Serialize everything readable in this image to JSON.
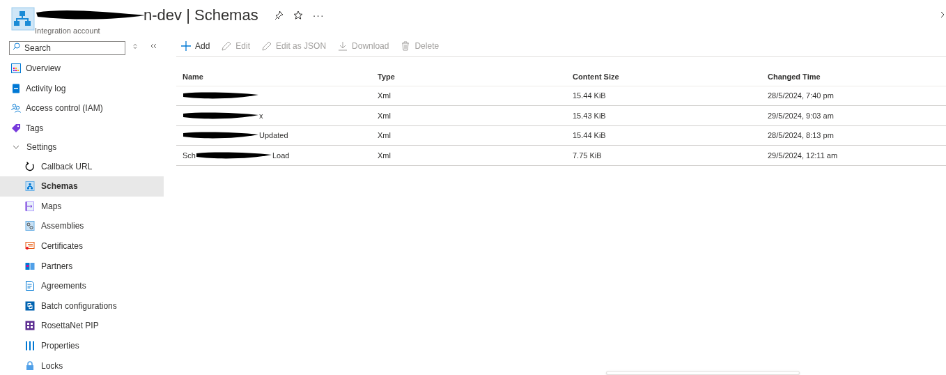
{
  "header": {
    "title": "n-dev | Schemas",
    "more": "···",
    "subtitle": "Integration account"
  },
  "sidebar": {
    "search": {
      "placeholder": "Search"
    },
    "items": [
      {
        "label": "Overview",
        "selected": false
      },
      {
        "label": "Activity log",
        "selected": false
      },
      {
        "label": "Access control (IAM)",
        "selected": false
      },
      {
        "label": "Tags",
        "selected": false
      },
      {
        "label": "Settings",
        "expanded": true,
        "children": [
          {
            "label": "Callback URL",
            "selected": false
          },
          {
            "label": "Schemas",
            "selected": true
          },
          {
            "label": "Maps",
            "selected": false
          },
          {
            "label": "Assemblies",
            "selected": false
          },
          {
            "label": "Certificates",
            "selected": false
          },
          {
            "label": "Partners",
            "selected": false
          },
          {
            "label": "Agreements",
            "selected": false
          },
          {
            "label": "Batch configurations",
            "selected": false
          },
          {
            "label": "RosettaNet PIP",
            "selected": false
          },
          {
            "label": "Properties",
            "selected": false
          },
          {
            "label": "Locks",
            "selected": false
          }
        ]
      }
    ]
  },
  "toolbar": [
    {
      "label": "Add",
      "disabled": false
    },
    {
      "label": "Edit",
      "disabled": true
    },
    {
      "label": "Edit as JSON",
      "disabled": true
    },
    {
      "label": "Download",
      "disabled": true
    },
    {
      "label": "Delete",
      "disabled": true
    }
  ],
  "table": {
    "columns": [
      "Name",
      "Type",
      "Content Size",
      "Changed Time"
    ],
    "rows": [
      {
        "type": "Xml",
        "size": "15.44 KiB",
        "changed": "28/5/2024, 7:40 pm"
      },
      {
        "name_parts": [
          "x"
        ],
        "type": "Xml",
        "size": "15.43 KiB",
        "changed": "29/5/2024, 9:03 am"
      },
      {
        "name_parts": [
          "Updated"
        ],
        "type": "Xml",
        "size": "15.44 KiB",
        "changed": "28/5/2024, 8:13 pm"
      },
      {
        "name_parts": [
          "Sch",
          "Load"
        ],
        "type": "Xml",
        "size": "7.75 KiB",
        "changed": "29/5/2024, 12:11 am"
      }
    ]
  }
}
